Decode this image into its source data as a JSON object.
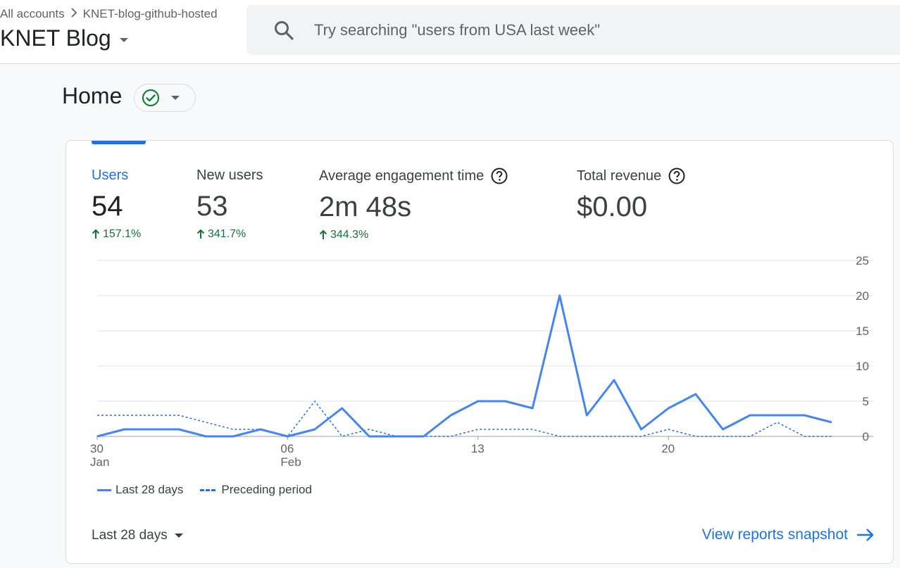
{
  "header": {
    "breadcrumb": {
      "account": "All accounts",
      "property": "KNET-blog-github-hosted"
    },
    "property_name": "KNET Blog",
    "search": {
      "placeholder": "Try searching \"users from USA last week\""
    }
  },
  "page": {
    "title": "Home",
    "status_icon": "check-circle-icon",
    "status_color": "#188038"
  },
  "metrics": [
    {
      "label": "Users",
      "value": "54",
      "change": "157.1%",
      "active": true,
      "help": false
    },
    {
      "label": "New users",
      "value": "53",
      "change": "341.7%",
      "active": false,
      "help": false
    },
    {
      "label": "Average engagement time",
      "value": "2m 48s",
      "change": "344.3%",
      "active": false,
      "help": true
    },
    {
      "label": "Total revenue",
      "value": "$0.00",
      "change": "",
      "active": false,
      "help": true
    }
  ],
  "chart_data": {
    "type": "line",
    "x": [
      "Jan 30",
      "Jan 31",
      "Feb 1",
      "Feb 2",
      "Feb 3",
      "Feb 4",
      "Feb 5",
      "Feb 6",
      "Feb 7",
      "Feb 8",
      "Feb 9",
      "Feb 10",
      "Feb 11",
      "Feb 12",
      "Feb 13",
      "Feb 14",
      "Feb 15",
      "Feb 16",
      "Feb 17",
      "Feb 18",
      "Feb 19",
      "Feb 20",
      "Feb 21",
      "Feb 22",
      "Feb 23",
      "Feb 24",
      "Feb 25",
      "Feb 26"
    ],
    "x_tick_labels": [
      {
        "index": 0,
        "day": "30",
        "month": "Jan"
      },
      {
        "index": 7,
        "day": "06",
        "month": "Feb"
      },
      {
        "index": 14,
        "day": "13",
        "month": ""
      },
      {
        "index": 21,
        "day": "20",
        "month": ""
      }
    ],
    "y_ticks": [
      "0",
      "5",
      "10",
      "15",
      "20",
      "25"
    ],
    "ylim": [
      0,
      25
    ],
    "grid": true,
    "series": [
      {
        "name": "Last 28 days",
        "style": "solid",
        "color": "#4285f4",
        "values": [
          0,
          1,
          1,
          1,
          0,
          0,
          1,
          0,
          1,
          4,
          0,
          0,
          0,
          3,
          5,
          5,
          4,
          20,
          3,
          8,
          1,
          4,
          6,
          1,
          3,
          3,
          3,
          2
        ]
      },
      {
        "name": "Preceding period",
        "style": "dashed",
        "color": "#1a73e8",
        "values": [
          3,
          3,
          3,
          3,
          2,
          1,
          1,
          0,
          5,
          0,
          1,
          0,
          0,
          0,
          1,
          1,
          1,
          0,
          0,
          0,
          0,
          1,
          0,
          0,
          0,
          2,
          0,
          0
        ]
      }
    ]
  },
  "footer": {
    "date_range": "Last 28 days",
    "view_link": "View reports snapshot"
  },
  "colors": {
    "accent": "#1a73e8",
    "positive": "#137333"
  }
}
